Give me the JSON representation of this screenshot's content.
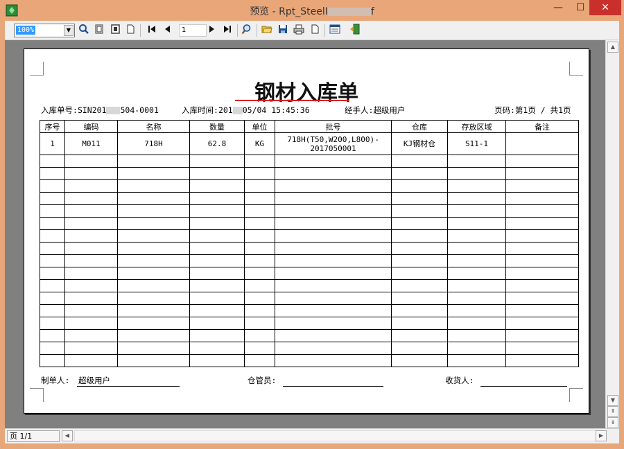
{
  "window": {
    "title": "预览 - Rpt_SteelI",
    "title_suffix": "f",
    "minimize": "—",
    "maximize": "☐",
    "close": "✕"
  },
  "toolbar": {
    "zoom": "100%",
    "page_input": "1",
    "icons": [
      "zoom-in-icon",
      "page-width-icon",
      "two-page-icon",
      "one-page-icon",
      "first-page-icon",
      "prev-page-icon",
      "next-page-icon",
      "last-page-icon",
      "find-icon",
      "open-icon",
      "save-icon",
      "print-icon",
      "page-setup-icon",
      "export-icon",
      "exit-icon"
    ]
  },
  "status": {
    "page": "页 1/1"
  },
  "report": {
    "title": "钢材入库单",
    "meta": {
      "no_label": "入库单号:",
      "no_value_a": "SIN201",
      "no_value_b": "504-0001",
      "time_label": "入库时间:",
      "time_value_a": "201",
      "time_value_b": "05/04 15:45:36",
      "handler_label": "经手人:",
      "handler_value": "超级用户",
      "page_label": "页码:",
      "page_value": "第1页 / 共1页"
    },
    "columns": [
      "序号",
      "编码",
      "名称",
      "数量",
      "单位",
      "批号",
      "仓库",
      "存放区域",
      "备注"
    ],
    "rows": [
      {
        "seq": "1",
        "code": "M011",
        "name": "718H",
        "qty": "62.8",
        "unit": "KG",
        "batch_1": "718H(T50,W200,L800)-",
        "batch_2": "2017050001",
        "warehouse": "KJ钢材仓",
        "area": "S11-1",
        "remark": ""
      }
    ],
    "footer": {
      "maker_label": "制单人:",
      "maker_value": "超级用户",
      "keeper_label": "仓管员:",
      "receiver_label": "收货人:"
    }
  },
  "colors": {
    "titlebar": "#e9a779",
    "close_button": "#c9302c",
    "title_underline": "#d32222",
    "viewport": "#808080"
  }
}
